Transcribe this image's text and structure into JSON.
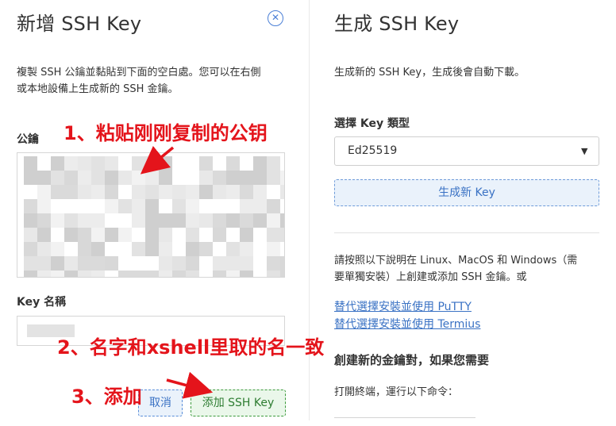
{
  "left": {
    "title": "新增 SSH Key",
    "description_line1": "複製 SSH 公鑰並黏貼到下面的空白處。您可以在右側",
    "description_line2": "或本地設備上生成新的 SSH 金鑰。",
    "pubkey_label": "公鑰",
    "keyname_label": "Key 名稱",
    "cancel_label": "取消",
    "add_label": "添加 SSH Key"
  },
  "annotations": {
    "step1": "1、粘贴刚刚复制的公钥",
    "step2": "2、名字和xshell里取的名一致",
    "step3": "3、添加",
    "arrow_color": "#e4141b"
  },
  "right": {
    "title": "生成 SSH Key",
    "description": "生成新的 SSH Key，生成後會自動下載。",
    "type_label": "選擇 Key 類型",
    "type_selected": "Ed25519",
    "generate_label": "生成新 Key",
    "instructions_line1": "請按照以下說明在 Linux、MacOS 和 Windows（需",
    "instructions_line2": "要單獨安裝）上創建或添加 SSH 金鑰。或",
    "link_putty": "替代選擇安裝並使用 PuTTY",
    "link_termius": "替代選擇安裝並使用 Termius",
    "create_heading": "創建新的金鑰對，如果您需要",
    "terminal_instruction": "打開終端，運行以下命令："
  },
  "colors": {
    "accent_blue": "#3a72c4",
    "accent_green": "#2e7d32",
    "annotation_red": "#e4141b"
  }
}
